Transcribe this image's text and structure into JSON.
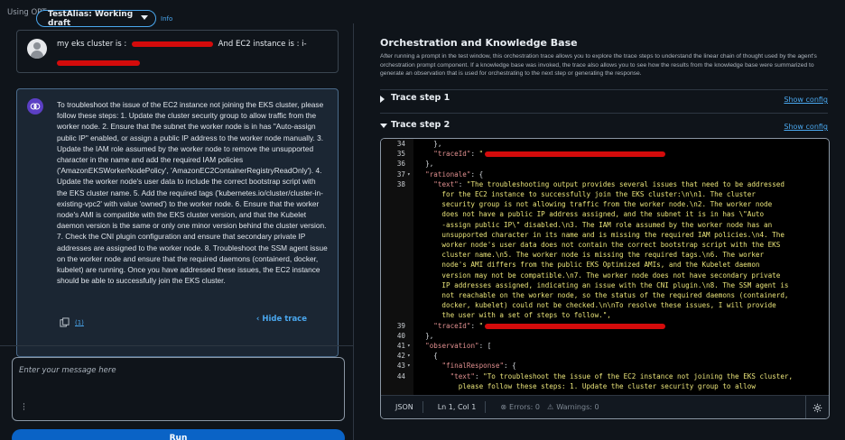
{
  "header": {
    "using_text": "Using OPT",
    "alias_label": "TestAlias: Working draft",
    "info_link": "Info"
  },
  "chat": {
    "user_message": {
      "prefix": "my eks cluster is :",
      "middle": "And EC2 instance is : i-"
    },
    "agent_message": {
      "text": "To troubleshoot the issue of the EC2 instance not joining the EKS cluster, please follow these steps: 1. Update the cluster security group to allow traffic from the worker node. 2. Ensure that the subnet the worker node is in has \"Auto-assign public IP\" enabled, or assign a public IP address to the worker node manually. 3. Update the IAM role assumed by the worker node to remove the unsupported character in the name and add the required IAM policies ('AmazonEKSWorkerNodePolicy', 'AmazonEC2ContainerRegistryReadOnly'). 4. Update the worker node's user data to include the correct bootstrap script with the EKS cluster name. 5. Add the required tags ('kubernetes.io/cluster/cluster-in-existing-vpc2' with value 'owned') to the worker node. 6. Ensure that the worker node's AMI is compatible with the EKS cluster version, and that the Kubelet daemon version is the same or only one minor version behind the cluster version. 7. Check the CNI plugin configuration and ensure that secondary private IP addresses are assigned to the worker node. 8. Troubleshoot the SSM agent issue on the worker node and ensure that the required daemons (containerd, docker, kubelet) are running. Once you have addressed these issues, the EC2 instance should be able to successfully join the EKS cluster.",
      "hide_trace_label": "Hide trace",
      "sources_link": "(1)"
    },
    "input_placeholder": "Enter your message here",
    "run_label": "Run"
  },
  "trace": {
    "title": "Orchestration and Knowledge Base",
    "description": "After running a prompt in the test window, this orchestration trace allows you to explore the trace steps to understand the linear chain of thought used by the agent's orchestration prompt component. If a knowledge base was invoked, the trace also allows you to see how the results from the knowledge base were summarized to generate an observation that is used for orchestrating to the next step or generating the response.",
    "steps": [
      {
        "label": "Trace step 1",
        "show_config": "Show config",
        "expanded": false
      },
      {
        "label": "Trace step 2",
        "show_config": "Show config",
        "expanded": true
      }
    ]
  },
  "editor": {
    "lines": [
      {
        "n": "34",
        "fold": "",
        "code": "    },"
      },
      {
        "n": "35",
        "fold": "",
        "code": "    \"traceId\": \""
      },
      {
        "n": "36",
        "fold": "",
        "code": "  },"
      },
      {
        "n": "37",
        "fold": "▾",
        "code": "  \"rationale\": {"
      },
      {
        "n": "38",
        "fold": "",
        "code": "    \"text\": \"The troubleshooting output provides several issues that need to be addressed"
      },
      {
        "n": "",
        "fold": "",
        "code": "      for the EC2 instance to successfully join the EKS cluster:\\n\\n1. The cluster"
      },
      {
        "n": "",
        "fold": "",
        "code": "      security group is not allowing traffic from the worker node.\\n2. The worker node"
      },
      {
        "n": "",
        "fold": "",
        "code": "      does not have a public IP address assigned, and the subnet it is in has \\\"Auto"
      },
      {
        "n": "",
        "fold": "",
        "code": "      -assign public IP\\\" disabled.\\n3. The IAM role assumed by the worker node has an"
      },
      {
        "n": "",
        "fold": "",
        "code": "      unsupported character in its name and is missing the required IAM policies.\\n4. The"
      },
      {
        "n": "",
        "fold": "",
        "code": "      worker node's user data does not contain the correct bootstrap script with the EKS"
      },
      {
        "n": "",
        "fold": "",
        "code": "      cluster name.\\n5. The worker node is missing the required tags.\\n6. The worker"
      },
      {
        "n": "",
        "fold": "",
        "code": "      node's AMI differs from the public EKS Optimized AMIs, and the Kubelet daemon"
      },
      {
        "n": "",
        "fold": "",
        "code": "      version may not be compatible.\\n7. The worker node does not have secondary private"
      },
      {
        "n": "",
        "fold": "",
        "code": "      IP addresses assigned, indicating an issue with the CNI plugin.\\n8. The SSM agent is"
      },
      {
        "n": "",
        "fold": "",
        "code": "      not reachable on the worker node, so the status of the required daemons (containerd,"
      },
      {
        "n": "",
        "fold": "",
        "code": "      docker, kubelet) could not be checked.\\n\\nTo resolve these issues, I will provide"
      },
      {
        "n": "",
        "fold": "",
        "code": "      the user with a set of steps to follow.\","
      },
      {
        "n": "39",
        "fold": "",
        "code": "    \"traceId\": \""
      },
      {
        "n": "40",
        "fold": "",
        "code": "  },"
      },
      {
        "n": "41",
        "fold": "▾",
        "code": "  \"observation\": ["
      },
      {
        "n": "42",
        "fold": "▾",
        "code": "    {"
      },
      {
        "n": "43",
        "fold": "▾",
        "code": "      \"finalResponse\": {"
      },
      {
        "n": "44",
        "fold": "",
        "code": "        \"text\": \"To troubleshoot the issue of the EC2 instance not joining the EKS cluster,"
      },
      {
        "n": "",
        "fold": "",
        "code": "          please follow these steps: 1. Update the cluster security group to allow"
      }
    ],
    "status": {
      "language": "JSON",
      "position": "Ln 1, Col 1",
      "errors": "Errors: 0",
      "warnings": "Warnings: 0"
    }
  }
}
